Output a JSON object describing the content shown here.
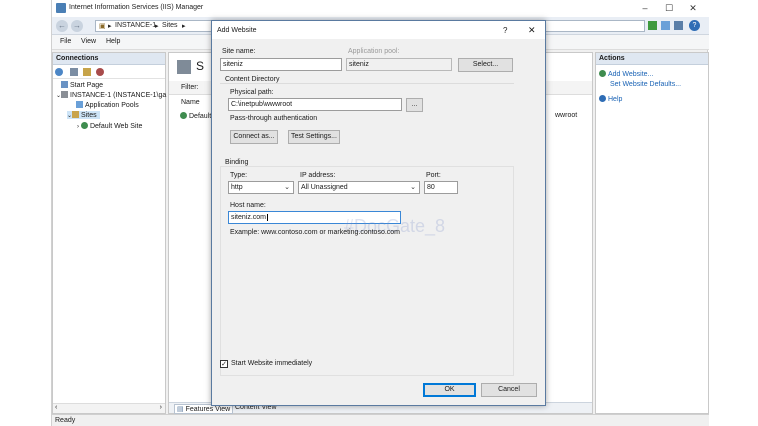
{
  "window": {
    "title": "Internet Information Services (IIS) Manager",
    "address": [
      "INSTANCE-1",
      "Sites"
    ],
    "menu": [
      "File",
      "View",
      "Help"
    ],
    "status": "Ready"
  },
  "connections": {
    "header": "Connections",
    "tree": [
      {
        "label": "Start Page"
      },
      {
        "label": "INSTANCE-1 (INSTANCE-1\\ga"
      },
      {
        "label": "Application Pools"
      },
      {
        "label": "Sites"
      },
      {
        "label": "Default Web Site"
      }
    ]
  },
  "center": {
    "title_partial": "S",
    "filter_label": "Filter:",
    "col_name": "Name",
    "row_partial": "Default",
    "path_partial": "wwroot",
    "view_tabs": [
      "Features View",
      "Content View"
    ]
  },
  "actions": {
    "header": "Actions",
    "items": [
      "Add Website...",
      "Set Website Defaults...",
      "Help"
    ]
  },
  "dialog": {
    "title": "Add Website",
    "help_glyph": "?",
    "close_glyph": "✕",
    "site_name_label": "Site name:",
    "site_name_value": "siteniz",
    "app_pool_label": "Application pool:",
    "app_pool_value": "siteniz",
    "select_button": "Select...",
    "content_dir_label": "Content Directory",
    "physical_path_label": "Physical path:",
    "physical_path_value": "C:\\inetpub\\wwwroot",
    "browse_button": "...",
    "passthrough_label": "Pass-through authentication",
    "connect_as_button": "Connect as...",
    "test_settings_button": "Test Settings...",
    "binding_label": "Binding",
    "type_label": "Type:",
    "type_value": "http",
    "ip_label": "IP address:",
    "ip_value": "All Unassigned",
    "port_label": "Port:",
    "port_value": "80",
    "host_label": "Host name:",
    "host_value": "siteniz.com",
    "example_text": "Example: www.contoso.com or marketing.contoso.com",
    "start_immediately_label": "Start Website immediately",
    "start_immediately_checked": true,
    "ok_button": "OK",
    "cancel_button": "Cancel",
    "watermark": "#DocGate_8"
  }
}
